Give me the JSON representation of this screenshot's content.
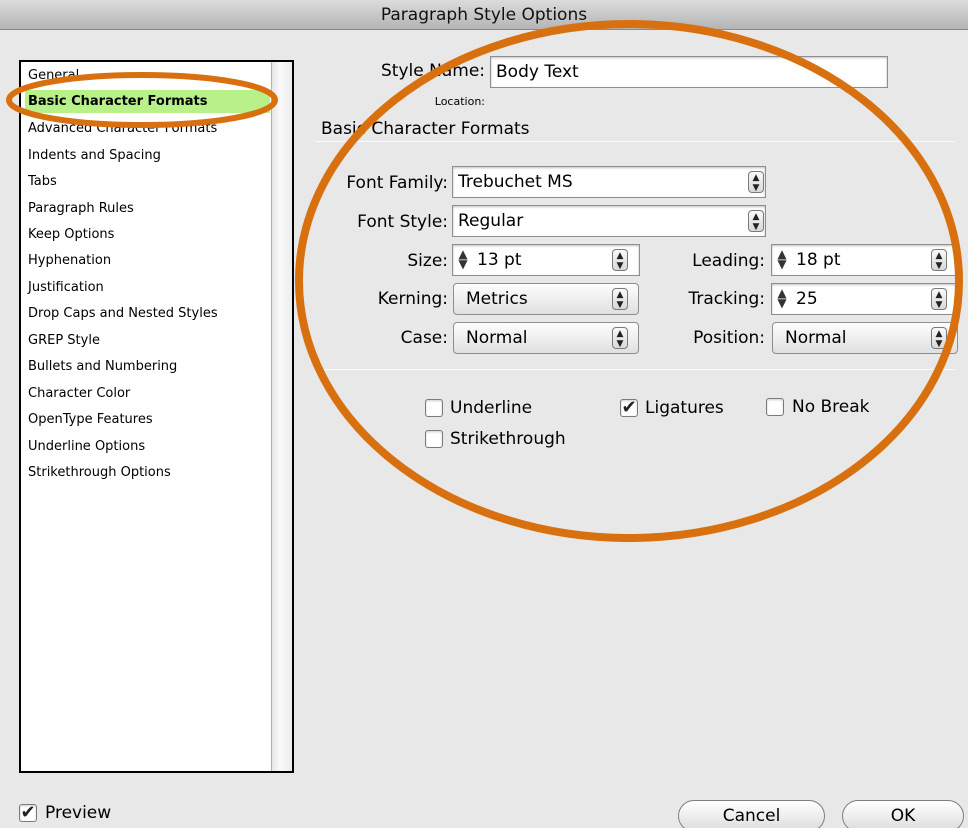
{
  "window": {
    "title": "Paragraph Style Options"
  },
  "sidebar": {
    "items": [
      {
        "label": "General"
      },
      {
        "label": "Basic Character Formats",
        "active": true
      },
      {
        "label": "Advanced Character Formats"
      },
      {
        "label": "Indents and Spacing"
      },
      {
        "label": "Tabs"
      },
      {
        "label": "Paragraph Rules"
      },
      {
        "label": "Keep Options"
      },
      {
        "label": "Hyphenation"
      },
      {
        "label": "Justification"
      },
      {
        "label": "Drop Caps and Nested Styles"
      },
      {
        "label": "GREP Style"
      },
      {
        "label": "Bullets and Numbering"
      },
      {
        "label": "Character Color"
      },
      {
        "label": "OpenType Features"
      },
      {
        "label": "Underline Options"
      },
      {
        "label": "Strikethrough Options"
      }
    ]
  },
  "style": {
    "name_label": "Style Name:",
    "name_value": "Body Text",
    "location_label": "Location:"
  },
  "section": {
    "title": "Basic Character Formats"
  },
  "fields": {
    "font_family_label": "Font Family:",
    "font_family_value": "Trebuchet MS",
    "font_style_label": "Font Style:",
    "font_style_value": "Regular",
    "size_label": "Size:",
    "size_value": "13 pt",
    "leading_label": "Leading:",
    "leading_value": "18 pt",
    "kerning_label": "Kerning:",
    "kerning_value": "Metrics",
    "tracking_label": "Tracking:",
    "tracking_value": "25",
    "case_label": "Case:",
    "case_value": "Normal",
    "position_label": "Position:",
    "position_value": "Normal"
  },
  "checkboxes": {
    "underline": {
      "label": "Underline",
      "checked": false
    },
    "ligatures": {
      "label": "Ligatures",
      "checked": true
    },
    "no_break": {
      "label": "No Break",
      "checked": false
    },
    "strikethrough": {
      "label": "Strikethrough",
      "checked": false
    },
    "preview": {
      "label": "Preview",
      "checked": true
    }
  },
  "buttons": {
    "cancel": "Cancel",
    "ok": "OK"
  },
  "colors": {
    "annotation": "#d9700f",
    "selection": "#b8f08a"
  },
  "icons": {
    "stepper": "stepper-arrows-icon",
    "popup": "popup-updown-icon",
    "check": "checkmark-icon"
  }
}
